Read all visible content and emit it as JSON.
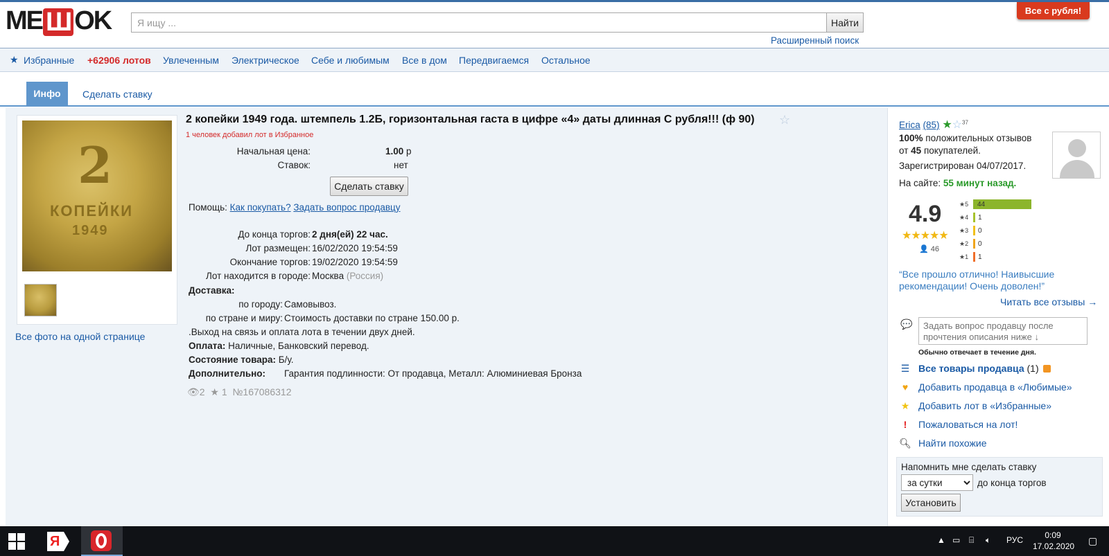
{
  "header": {
    "logo": {
      "left": "ME",
      "mid": "Ш",
      "right": "OK"
    },
    "search_placeholder": "Я ищу ...",
    "search_button": "Найти",
    "advanced_search": "Расширенный поиск",
    "promo": "Все с рубля!"
  },
  "nav": {
    "favorites": "Избранные",
    "lots": "+62906 лотов",
    "items": [
      "Увлеченным",
      "Электрическое",
      "Себе и любимым",
      "Все в дом",
      "Передвигаемся",
      "Остальное"
    ]
  },
  "tabs": {
    "info": "Инфо",
    "bid": "Сделать ставку"
  },
  "images": {
    "coin_denomination": "2",
    "coin_word": "КОПЕЙКИ",
    "coin_year": "1949",
    "all_photos": "Все фото на одной странице"
  },
  "lot": {
    "title": "2 копейки 1949 года. штемпель 1.2Б, горизонтальная гаста в цифре «4» даты длинная С рубля!!! (ф 90)",
    "fav_note": "1 человек добавил лот в Избранное",
    "start_price_label": "Начальная цена:",
    "start_price_value": "1.00",
    "start_price_currency": "р",
    "bids_label": "Ставок:",
    "bids_value": "нет",
    "bid_button": "Сделать ставку",
    "help_label": "Помощь:",
    "help_how": "Как покупать?",
    "help_ask": "Задать вопрос продавцу",
    "ends_in_label": "До конца торгов:",
    "ends_in_value": "2 дня(ей) 22 час.",
    "placed_label": "Лот размещен:",
    "placed_value": "16/02/2020 19:54:59",
    "end_label": "Окончание торгов:",
    "end_value": "19/02/2020 19:54:59",
    "city_label": "Лот находится в городе:",
    "city_value": "Москва",
    "country_value": "(Россия)",
    "delivery_label": "Доставка:",
    "city_delivery_label": "по городу:",
    "city_delivery_value": "Самовывоз.",
    "country_delivery_label": "по стране и миру:",
    "country_delivery_value": "Стоимость доставки по стране 150.00 р.",
    "delivery_note": ".Выход на связь и оплата лота в течении двух дней.",
    "payment_label": "Оплата:",
    "payment_value": "Наличные, Банковский перевод.",
    "condition_label": "Состояние товара:",
    "condition_value": "Б/у.",
    "extra_label": "Дополнительно:",
    "extra_value": "Гарантия подлинности: От продавца, Металл: Алюминиевая Бронза",
    "views": "2",
    "stars": "1",
    "lot_number": "№167086312"
  },
  "seller": {
    "name": "Erica",
    "count": "(85)",
    "badge_num": "37",
    "positive_pct": "100%",
    "positive_text": "положительных отзывов",
    "from_text": "от",
    "buyers_count": "45",
    "buyers_text": "покупателей.",
    "registered": "Зарегистрирован 04/07/2017.",
    "online_label": "На сайте:",
    "online_value": "55 минут назад.",
    "rating": "4.9",
    "rating_votes": "46",
    "rating_bars": [
      {
        "star": "★5",
        "count": 44,
        "color": "#8cb52c"
      },
      {
        "star": "★4",
        "count": 1,
        "color": "#a6c22c"
      },
      {
        "star": "★3",
        "count": 0,
        "color": "#f1c01a"
      },
      {
        "star": "★2",
        "count": 0,
        "color": "#f0a51c"
      },
      {
        "star": "★1",
        "count": 1,
        "color": "#ef6e2a"
      }
    ],
    "review": "“Все прошло отлично! Наивысшие рекомендации! Очень доволен!”",
    "read_all": "Читать все отзывы →",
    "ask_placeholder": "Задать вопрос продавцу после прочтения описания ниже ↓",
    "ask_note": "Обычно отвечает в течение дня.",
    "all_goods": "Все товары продавца",
    "all_goods_count": "(1)",
    "add_seller_fav": "Добавить продавца в «Любимые»",
    "add_lot_fav": "Добавить лот в «Избранные»",
    "report": "Пожаловаться на лот!",
    "find_similar": "Найти похожие",
    "remind_title": "Напомнить мне сделать ставку",
    "remind_option": "за сутки",
    "remind_after": "до конца торгов",
    "remind_button": "Установить"
  },
  "taskbar": {
    "yandex": "Я",
    "lang": "РУС",
    "time": "0:09",
    "date": "17.02.2020"
  }
}
